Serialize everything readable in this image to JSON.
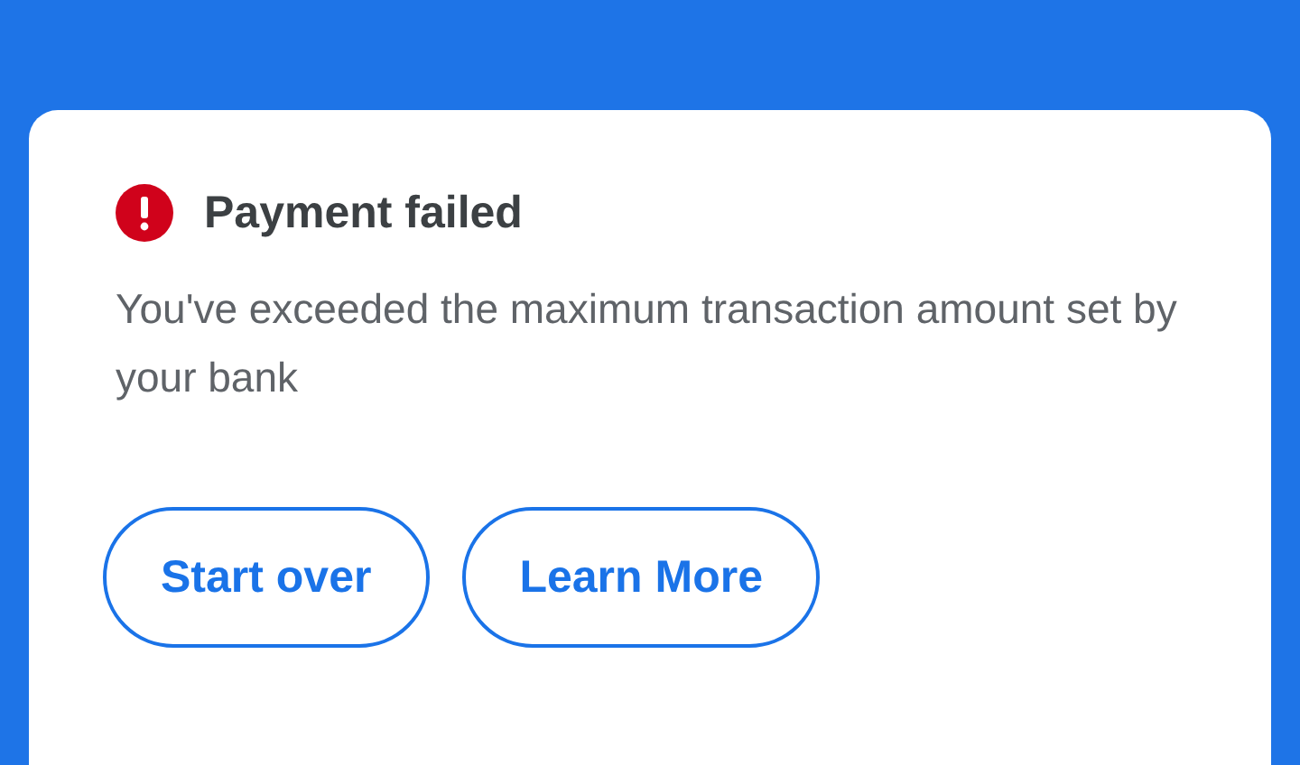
{
  "dialog": {
    "title": "Payment failed",
    "message": "You've exceeded the maximum transaction amount set by your bank",
    "buttons": [
      {
        "label": "Start over"
      },
      {
        "label": "Learn More"
      }
    ]
  }
}
